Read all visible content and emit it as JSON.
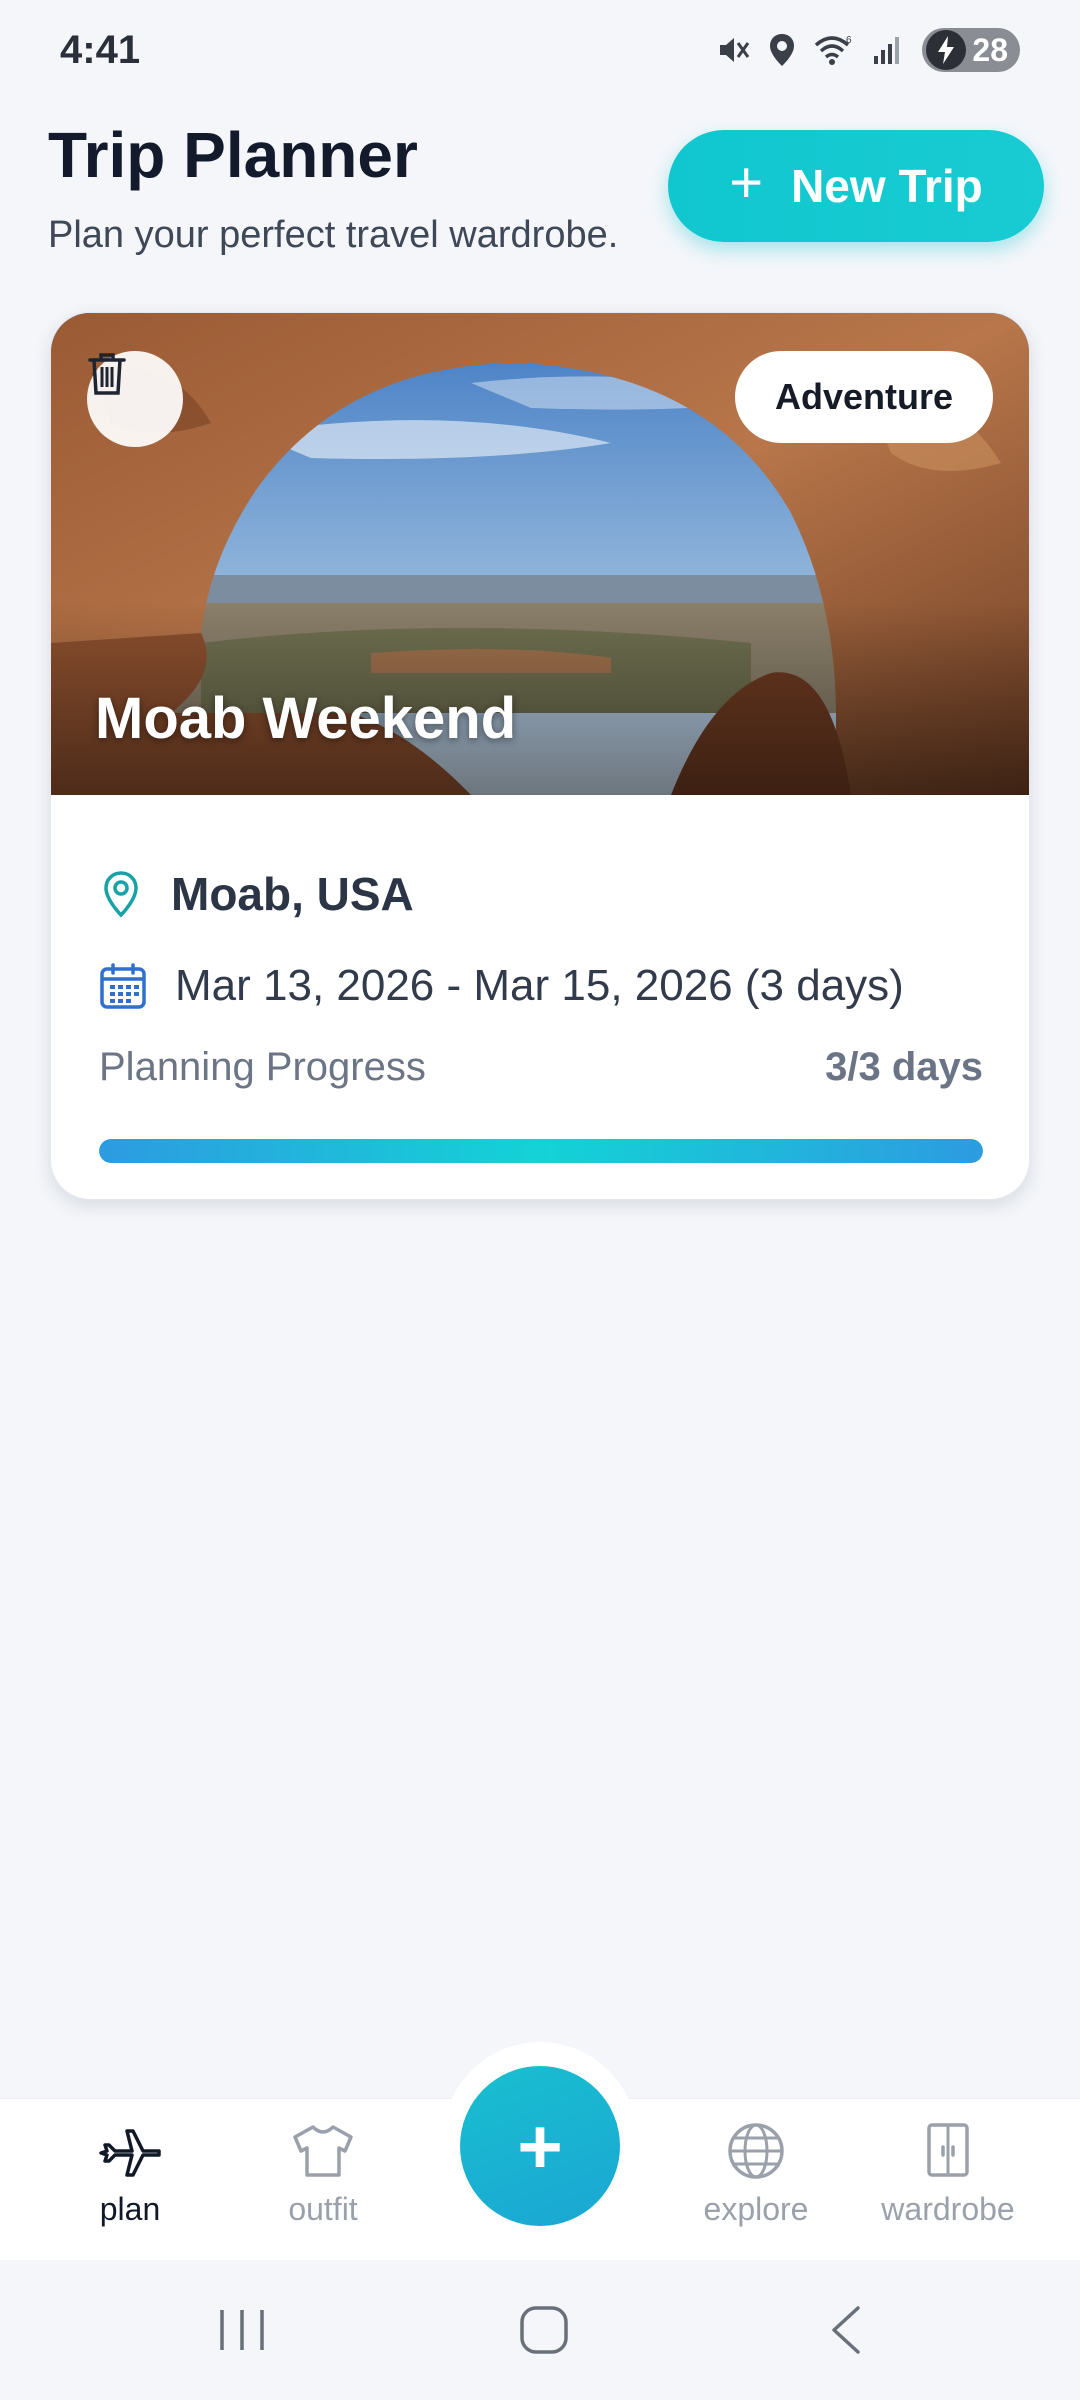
{
  "status_bar": {
    "time": "4:41",
    "battery_level": "28",
    "icons": [
      "mute-icon",
      "location-icon",
      "wifi-icon",
      "signal-icon",
      "battery-charging-icon"
    ]
  },
  "header": {
    "title": "Trip Planner",
    "subtitle": "Plan your perfect travel wardrobe.",
    "new_trip_label": "New Trip"
  },
  "trips": [
    {
      "name": "Moab Weekend",
      "category": "Adventure",
      "location": "Moab, USA",
      "dates": "Mar 13, 2026 - Mar 15, 2026 (3 days)",
      "progress_label": "Planning Progress",
      "progress_value": "3/3 days",
      "progress_fraction": 1.0
    }
  ],
  "bottom_nav": {
    "items": [
      {
        "label": "plan",
        "icon": "airplane-icon",
        "active": true
      },
      {
        "label": "outfit",
        "icon": "shirt-icon",
        "active": false
      },
      {
        "label": "explore",
        "icon": "globe-icon",
        "active": false
      },
      {
        "label": "wardrobe",
        "icon": "wardrobe-icon",
        "active": false
      }
    ],
    "fab_symbol": "+"
  },
  "colors": {
    "accent": "#11c7cf",
    "background": "#f4f6fa",
    "location_icon": "#17a2a6",
    "calendar_icon": "#2f6fd0"
  }
}
